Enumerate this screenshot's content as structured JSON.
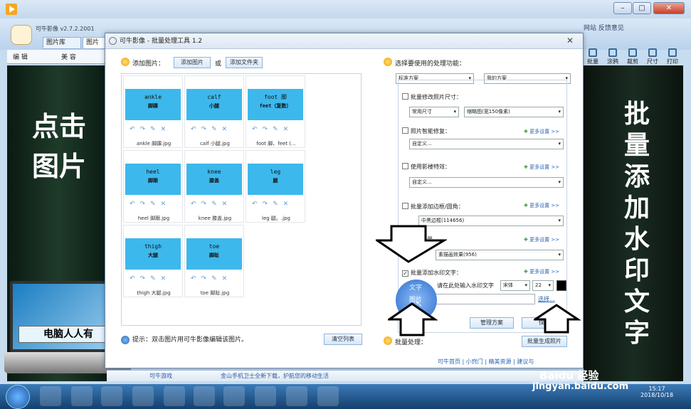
{
  "app": {
    "title": "可牛影像 v2.7.2.2001",
    "tab_library": "图片库",
    "tab_image": "图片",
    "edit": "编 辑",
    "beauty": "美 容"
  },
  "header_links": "网站  反馈意见",
  "right_tools": [
    "批量",
    "涂鸦",
    "裁剪",
    "尺寸",
    "打印"
  ],
  "left_vertical_text": "点击图片",
  "right_vertical_text": "批量添加水印文字",
  "laptop_label": "电脑人人有",
  "dialog": {
    "title": "可牛影像 - 批量处理工具 1.2",
    "add_images_label": "添加图片：",
    "add_images_btn": "添加图片",
    "or": "或",
    "add_folder_btn": "添加文件夹",
    "tip": "提示：双击图片用可牛影像编辑该图片。",
    "clear_list": "清空列表",
    "thumbnails": [
      {
        "word": "ankle",
        "cn": "脚踝",
        "file": "ankle 脚踝.jpg"
      },
      {
        "word": "calf",
        "cn": "小腿",
        "file": "calf 小腿.jpg"
      },
      {
        "word": "foot 脚",
        "cn": "feet（复数）",
        "file": "foot 脚、feet (..."
      },
      {
        "word": "heel",
        "cn": "脚跟",
        "file": "heel 脚跟.jpg"
      },
      {
        "word": "knee",
        "cn": "膝盖",
        "file": "knee 膝盖.jpg"
      },
      {
        "word": "leg",
        "cn": "腿",
        "file": "leg 腿。.jpg"
      },
      {
        "word": "thigh",
        "cn": "大腿",
        "file": "thigh 大腿.jpg"
      },
      {
        "word": "toe",
        "cn": "脚趾",
        "file": "toe 脚趾.jpg"
      }
    ],
    "select_function": "选择要使用的处理功能：",
    "standard_scheme": "标准方案",
    "my_scheme": "我的方案",
    "resize_label": "批量修改照片尺寸：",
    "common_size": "常用尺寸",
    "thumb_size": "缩略图(宽150像素)",
    "smart_fix_label": "照片智能修复：",
    "custom": "自定义...",
    "custom2": "自定义...",
    "effects_label": "使用影楼特效：",
    "more_settings": "更多设置 >>",
    "border_label": "批量添加边框/圆角：",
    "border_value": "中黑边框(114656)",
    "scene_label": "场景",
    "scene_value": "素描画效果(956)",
    "watermark_label": "批量添加水印文字：",
    "watermark_input_placeholder": "请在此处输入水印文字",
    "font": "宋体",
    "font_size": "22",
    "wm_text_opt": "文字",
    "wm_image_opt": "图片",
    "choose": "选择...",
    "manage_scheme": "管理方案",
    "save_scheme": "保存",
    "batch_label": "批量处理：",
    "batch_btn": "批量生成照片",
    "footer_links": "可牛首页 | 小窍门 | 精美资源 | 建议与"
  },
  "status_strip": {
    "game": "可牛游戏",
    "news": "金山手机卫士全新下载，护航您的移动生活"
  },
  "clock": {
    "time": "15:17",
    "date": "2018/10/18"
  },
  "watermark": {
    "brand": "Baidu 经验",
    "url": "jingyan.baidu.com"
  }
}
